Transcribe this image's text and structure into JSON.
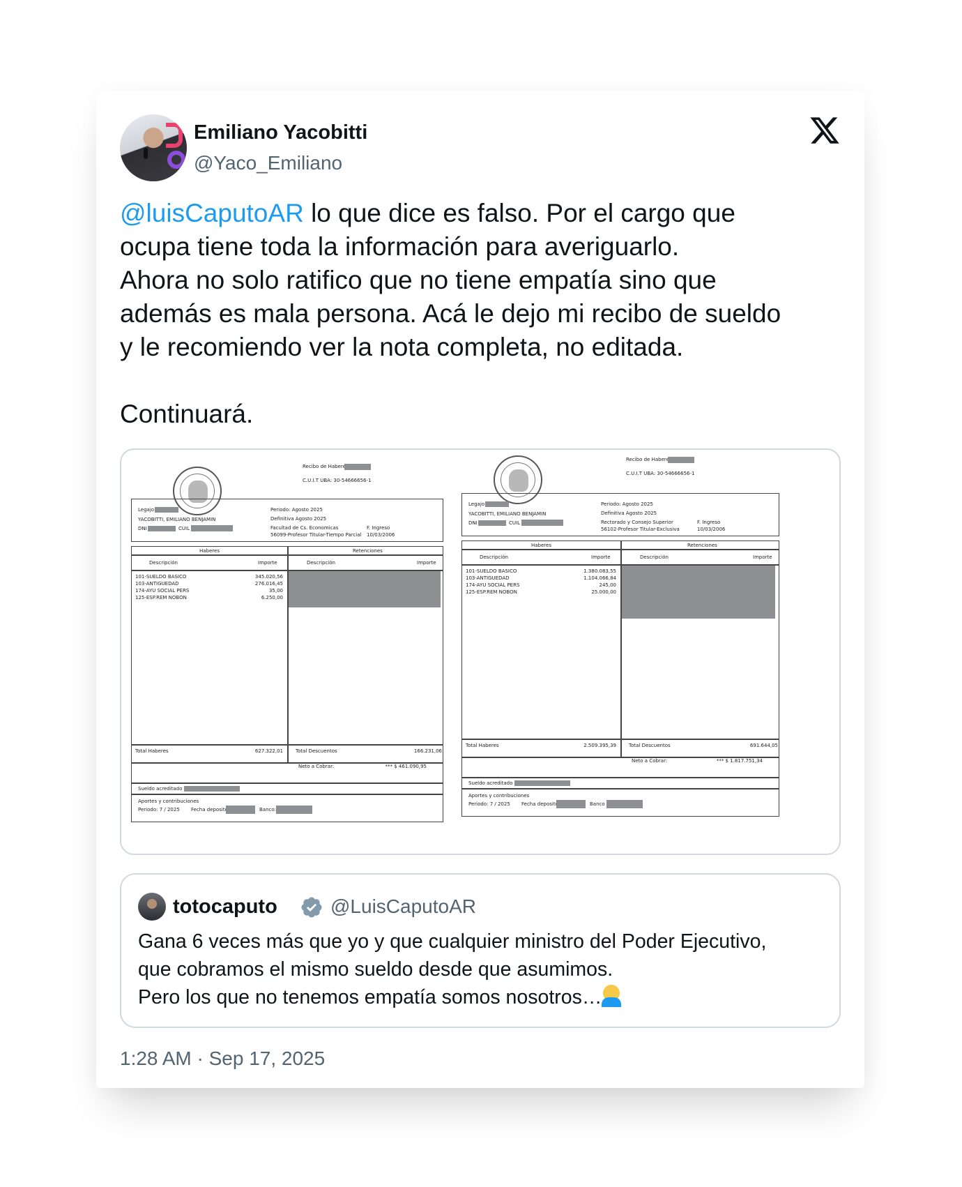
{
  "author": {
    "name": "Emiliano Yacobitti",
    "handle": "@Yaco_Emiliano"
  },
  "tweet": {
    "mention": "@luisCaputoAR",
    "text": " lo que dice es falso. Por el cargo que\nocupa tiene toda la información para averiguarlo.\nAhora no solo ratifico que no tiene empatía sino que\nademás es mala persona. Acá le dejo mi recibo de sueldo\ny le recomiendo ver la nota completa, no editada.\n\nContinuará."
  },
  "receipts": [
    {
      "header_title": "Recibo de Haberes",
      "cuit": "C.U.I.T UBA: 30-54666656-1",
      "legajo_label": "Legajo",
      "employee": "YACOBITTI, EMILIANO BENJAMIN",
      "dni_label": "DNI",
      "cuil_label": "CUIL",
      "periodo": "Periodo: Agosto 2025",
      "definitiva": "Definitiva Agosto 2025",
      "dependencia": "Facultad de Cs. Economicas",
      "cargo": "56099-Profesor Titular-Tiempo Parcial",
      "ingreso_label": "F. Ingreso",
      "ingreso_date": "10/03/2006",
      "haberes_label": "Haberes",
      "retenciones_label": "Retenciones",
      "desc_label": "Descripción",
      "importe_label": "Importe",
      "items": [
        {
          "desc": "101-SUELDO BASICO",
          "amount": "345.020,56"
        },
        {
          "desc": "103-ANTIGUEDAD",
          "amount": "276.016,45"
        },
        {
          "desc": "174-AYU SOCIAL PERS",
          "amount": "35,00"
        },
        {
          "desc": "125-ESP.REM NOBON",
          "amount": "6.250,00"
        }
      ],
      "total_haberes_label": "Total Haberes",
      "total_haberes": "627.322,01",
      "total_desc_label": "Total Descuentos",
      "total_desc": "166.231,06",
      "neto_label": "Neto a Cobrar:",
      "neto": "*** $ 461.090,95",
      "acreditado_label": "Sueldo acreditado en",
      "aportes_label": "Aportes y contribuciones",
      "periodo_pago": "Periodo: 7 / 2025",
      "fecha_dep_label": "Fecha deposito",
      "banco_label": "Banco:"
    },
    {
      "header_title": "Recibo de Haberes:",
      "cuit": "C.U.I.T UBA: 30-54666656-1",
      "legajo_label": "Legajo",
      "employee": "YACOBITTI, EMILIANO BENJAMIN",
      "dni_label": "DNI",
      "cuil_label": "CUIL",
      "periodo": "Periodo: Agosto 2025",
      "definitiva": "Definitiva Agosto 2025",
      "dependencia": "Rectorado y Consejo Superior",
      "cargo": "56102-Profesor Titular-Exclusiva",
      "ingreso_label": "F. Ingreso",
      "ingreso_date": "10/03/2006",
      "haberes_label": "Haberes",
      "retenciones_label": "Retenciones",
      "desc_label": "Descripción",
      "importe_label": "Importe",
      "items": [
        {
          "desc": "101-SUELDO BASICO",
          "amount": "1.380.083,55"
        },
        {
          "desc": "103-ANTIGUEDAD",
          "amount": "1.104.066,84"
        },
        {
          "desc": "174-AYU SOCIAL PERS",
          "amount": "245,00"
        },
        {
          "desc": "125-ESP.REM NOBON",
          "amount": "25.000,00"
        }
      ],
      "total_haberes_label": "Total Haberes",
      "total_haberes": "2.509.395,39",
      "total_desc_label": "Total Descuentos",
      "total_desc": "691.644,05",
      "neto_label": "Neto a Cobrar:",
      "neto": "*** $ 1.817.751,34",
      "acreditado_label": "Sueldo acreditado en",
      "aportes_label": "Aportes y contribuciones",
      "periodo_pago": "Periodo: 7 / 2025",
      "fecha_dep_label": "Fecha deposito",
      "banco_label": "Banco"
    }
  ],
  "quote": {
    "name": "totocaputo",
    "handle": "@LuisCaputoAR",
    "text": "Gana 6 veces más que yo y que cualquier ministro del Poder Ejecutivo,\nque cobramos el mismo sueldo desde que asumimos.\nPero los que no tenemos empatía somos nosotros…",
    "emoji": "person-facepalming-emoji"
  },
  "timestamp": "1:28 AM · Sep 17, 2025",
  "colors": {
    "link": "#1d9bf0",
    "secondary_text": "#536471",
    "border": "#cfd9de",
    "redaction": "#8d8f92"
  },
  "icons": [
    "x-logo-icon",
    "verified-badge-icon"
  ]
}
